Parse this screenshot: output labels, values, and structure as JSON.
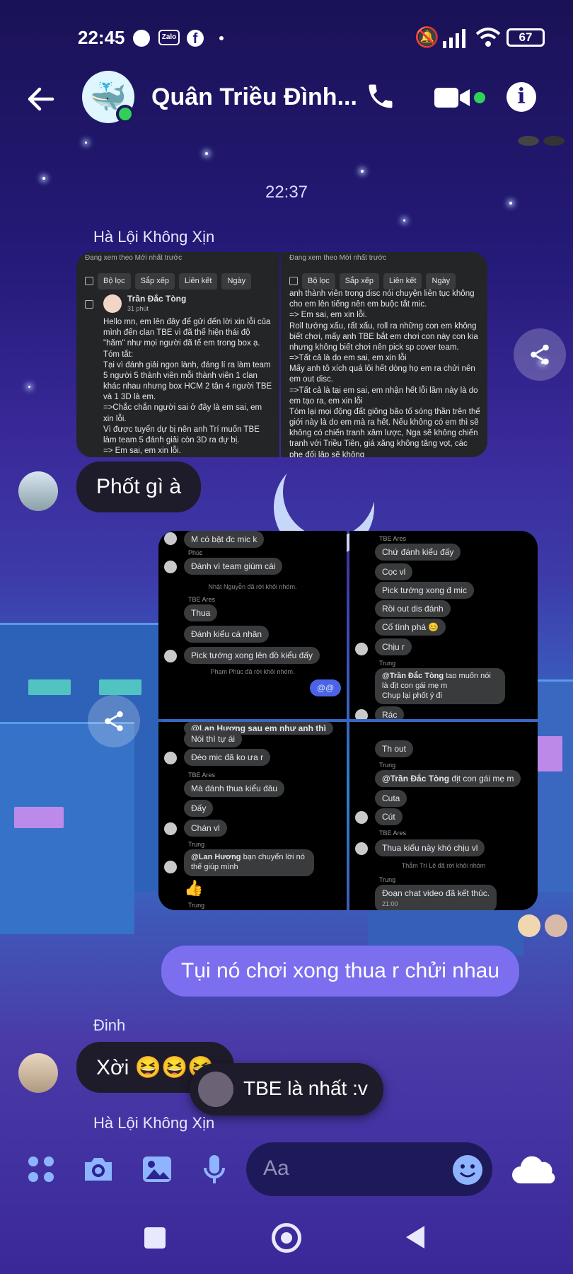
{
  "status_bar": {
    "time": "22:45",
    "notification_icons": [
      "messenger-icon",
      "zalo-icon",
      "facebook-icon",
      "dot"
    ],
    "zalo_label": "Zalo",
    "battery": "67"
  },
  "header": {
    "title": "Quân Triều Đình...",
    "back_icon": "arrow-left-icon",
    "call_icon": "phone-icon",
    "video_icon": "video-icon",
    "info_icon": "info-icon"
  },
  "timestamp": "22:37",
  "messages": [
    {
      "sender": "Hà Lội Không Xịn",
      "type": "image-pair"
    },
    {
      "text": "Phốt gì à",
      "type": "text",
      "direction": "incoming"
    },
    {
      "type": "image-grid"
    },
    {
      "text": "Tụi nó chơi xong thua r chửi nhau",
      "type": "text",
      "direction": "outgoing"
    },
    {
      "sender": "Đinh",
      "text": "Xời 😆😆😆",
      "type": "text",
      "direction": "incoming"
    },
    {
      "text": "TBE là nhất :v",
      "type": "reply-preview"
    },
    {
      "sender": "Hà Lội Không Xịn",
      "type": "typing"
    }
  ],
  "shot_left": {
    "topbar": "Đang xem theo Mới nhất trước",
    "filters": [
      "Bộ lọc",
      "Sắp xếp",
      "Liên kết",
      "Ngày"
    ],
    "author": "Trần Đắc Tòng",
    "time": "31 phút",
    "body": "Hello mn, em lên đây để gửi đến lời xin lỗi của mình đến clan TBE vì đã thể hiện thái độ \"hãm\" như mọi người đã tế em trong box ạ.\nTóm tắt:\nTại vì đánh giải ngon lành, đáng lí ra làm team 5 người 5 thành viên mỗi thành viên 1 clan khác nhau nhưng box HCM 2 tận 4 người TBE và 1 3D là em.\n=>Chắc chắn người sai ở đây là em sai, em xin lỗi.\nVì được tuyển dự bị nên anh Trí muốn TBE làm team 5 đánh giải còn 3D ra dự bị.\n=> Em sai, em xin lỗi.\nVào trận mic discord em có nói lên nhưng mấy"
  },
  "shot_right": {
    "topbar": "Đang xem theo Mới nhất trước",
    "filters": [
      "Bộ lọc",
      "Sắp xếp",
      "Liên kết",
      "Ngày"
    ],
    "body": "anh thành viên trong disc nói chuyện liên tục không cho em lên tiếng nên em buộc tắt mic.\n=> Em sai, em xin lỗi.\nRoll tướng xấu, rất xấu, roll ra những con em không biết chơi, mấy anh TBE bắt em chơi con này con kia nhưng không biết chơi nên pick sp cover team.\n=>Tất cả là do em sai, em xin lỗi\nMấy anh tô xích quá lôi hết dòng họ em ra chửi nên em out disc.\n=>Tất cả là tại em sai, em nhận hết lỗi lầm này là do em tạo ra, em xin lỗi\nTóm lại mọi động đất giông bão tố sóng thần trên thế giới này là do em mà ra hết. Nếu không có em thì sẽ không có chiến tranh xâm lược, Nga sẽ không chiến tranh với Triều Tiên, giá xăng không tăng vọt, các phe đối lập sẽ không"
  },
  "grid_tl": {
    "m1": "M có bật đc mic k",
    "n1": "Phúc",
    "m2": "Đánh vì team giùm cái",
    "s1": "Nhật Nguyễn đã rời khỏi nhóm.",
    "n2": "TBE Ares",
    "m3": "Thua",
    "m4": "Đánh kiểu cá nhân",
    "m5": "Pick tướng xong lên đồ kiểu đấy",
    "s2": "Phạm Phúc đã rời khỏi nhóm.",
    "m6": "@@"
  },
  "grid_tr": {
    "n1": "TBE Ares",
    "m1": "Chứ đánh kiểu đấy",
    "m2": "Cọc vl",
    "m3": "Pick tướng xong đ mic",
    "m4": "Rồi out dis đánh",
    "m5": "Cố tình phá 😊",
    "m6": "Chịu r",
    "n2": "Trung",
    "mention": "@Trần Đắc Tòng",
    "m7": "tao muốn nói là địt con gái mẹ m",
    "m8": "Chụp lại phốt ý đi",
    "m9": "Rác"
  },
  "grid_bl": {
    "top": "@Lan Hương sau em như anh thì",
    "m1": "Nói thì tự ái",
    "m2": "Đéo mic đã ko ưa r",
    "n1": "TBE Ares",
    "m3": "Mà đánh thua kiểu đâu",
    "m4": "Đấy",
    "m5": "Chán vl",
    "n2": "Trung",
    "mention": "@Lan Hương",
    "m6": "bạn chuyển lời nó thế giúp mình",
    "n3": "Trung"
  },
  "grid_br": {
    "m1": "Th out",
    "n1": "Trung",
    "mention": "@Trần Đắc Tòng",
    "m2": "địt con gái mẹ m",
    "m3": "Cuta",
    "m4": "Cút",
    "n2": "TBE Ares",
    "m5": "Thua kiểu này khó chịu vl",
    "s1": "Thắm Trí Lê đã rời khỏi nhóm",
    "n3": "Trung",
    "m6": "Đoạn chat video đã kết thúc.",
    "m7": "21:00"
  },
  "composer": {
    "placeholder": "Aa",
    "icons": [
      "apps-icon",
      "camera-icon",
      "gallery-icon",
      "mic-icon",
      "emoji-icon",
      "cloud-icon"
    ]
  },
  "nav": [
    "recents-square",
    "home-circle",
    "back-triangle"
  ],
  "colors": {
    "outgoing_bubble": "#7b6ff0",
    "incoming_bubble": "#1e1c2a",
    "online": "#31d158"
  }
}
